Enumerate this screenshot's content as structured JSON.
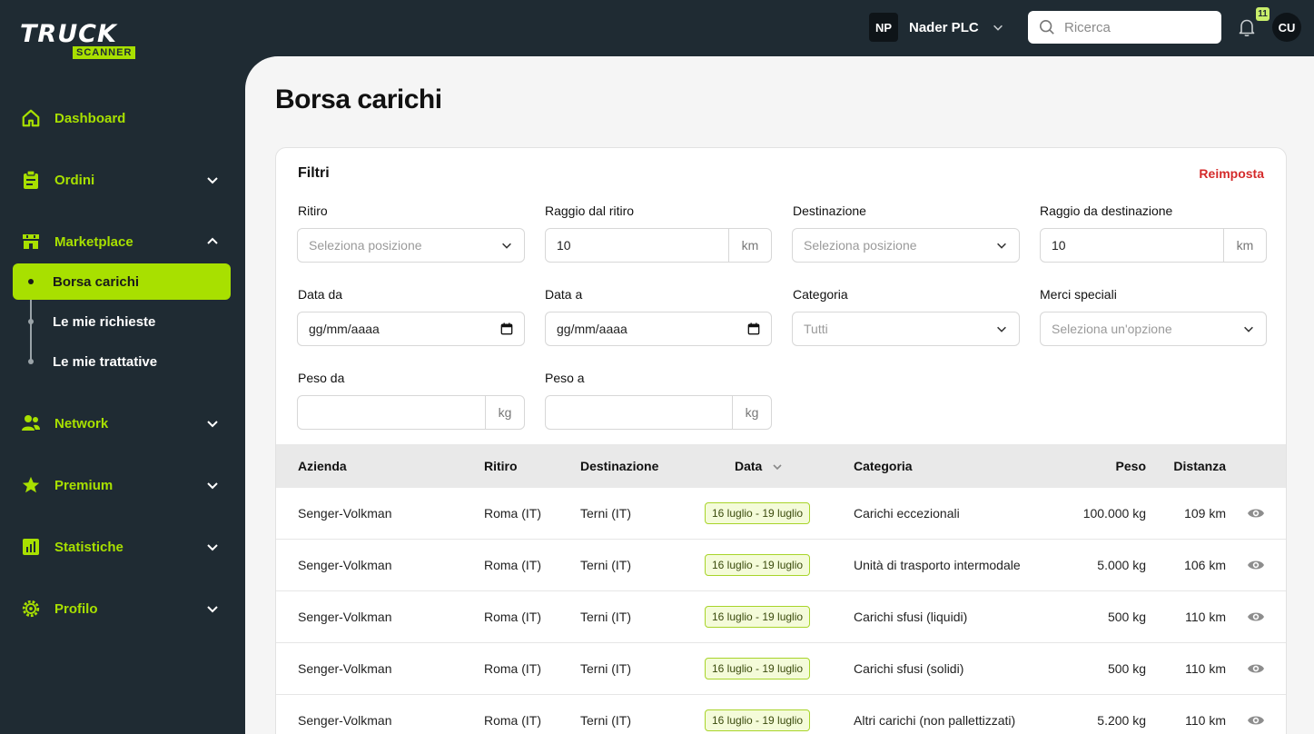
{
  "brand": {
    "top": "TRUCK",
    "bottom": "SCANNER"
  },
  "sidebar": {
    "items": [
      {
        "label": "Dashboard",
        "icon": "home-icon"
      },
      {
        "label": "Ordini",
        "icon": "clipboard-icon"
      },
      {
        "label": "Marketplace",
        "icon": "marketplace-icon"
      },
      {
        "label": "Network",
        "icon": "users-icon"
      },
      {
        "label": "Premium",
        "icon": "star-icon"
      },
      {
        "label": "Statistiche",
        "icon": "bar-chart-icon"
      },
      {
        "label": "Profilo",
        "icon": "gear-icon"
      }
    ],
    "marketplace_sub": [
      {
        "label": "Borsa carichi",
        "active": true
      },
      {
        "label": "Le mie richieste",
        "active": false
      },
      {
        "label": "Le mie trattative",
        "active": false
      }
    ]
  },
  "topbar": {
    "company_initials": "NP",
    "company_name": "Nader PLC",
    "search_placeholder": "Ricerca",
    "notifications": "11",
    "user_initials": "CU"
  },
  "page": {
    "title": "Borsa carichi"
  },
  "filters": {
    "title": "Filtri",
    "reset": "Reimposta",
    "pickup_label": "Ritiro",
    "pickup_placeholder": "Seleziona posizione",
    "pickup_radius_label": "Raggio dal ritiro",
    "pickup_radius_value": "10",
    "destination_label": "Destinazione",
    "destination_placeholder": "Seleziona posizione",
    "destination_radius_label": "Raggio da destinazione",
    "destination_radius_value": "10",
    "km_unit": "km",
    "date_from_label": "Data da",
    "date_from_placeholder": "gg/mm/aaaa",
    "date_to_label": "Data a",
    "date_to_placeholder": "gg/mm/aaaa",
    "category_label": "Categoria",
    "category_value": "Tutti",
    "special_label": "Merci speciali",
    "special_placeholder": "Seleziona un'opzione",
    "weight_from_label": "Peso da",
    "weight_to_label": "Peso a",
    "kg_unit": "kg"
  },
  "table": {
    "headers": {
      "company": "Azienda",
      "pickup": "Ritiro",
      "destination": "Destinazione",
      "date": "Data",
      "category": "Categoria",
      "weight": "Peso",
      "distance": "Distanza"
    },
    "rows": [
      {
        "company": "Senger-Volkman",
        "pickup": "Roma (IT)",
        "destination": "Terni (IT)",
        "date": "16 luglio - 19 luglio",
        "category": "Carichi eccezionali",
        "weight": "100.000 kg",
        "distance": "109 km"
      },
      {
        "company": "Senger-Volkman",
        "pickup": "Roma (IT)",
        "destination": "Terni (IT)",
        "date": "16 luglio - 19 luglio",
        "category": "Unità di trasporto intermodale",
        "weight": "5.000 kg",
        "distance": "106 km"
      },
      {
        "company": "Senger-Volkman",
        "pickup": "Roma (IT)",
        "destination": "Terni (IT)",
        "date": "16 luglio - 19 luglio",
        "category": "Carichi sfusi (liquidi)",
        "weight": "500 kg",
        "distance": "110 km"
      },
      {
        "company": "Senger-Volkman",
        "pickup": "Roma (IT)",
        "destination": "Terni (IT)",
        "date": "16 luglio - 19 luglio",
        "category": "Carichi sfusi (solidi)",
        "weight": "500 kg",
        "distance": "110 km"
      },
      {
        "company": "Senger-Volkman",
        "pickup": "Roma (IT)",
        "destination": "Terni (IT)",
        "date": "16 luglio - 19 luglio",
        "category": "Altri carichi (non pallettizzati)",
        "weight": "5.200 kg",
        "distance": "110 km"
      }
    ]
  },
  "colors": {
    "accent": "#a8e000",
    "sidebar_bg": "#1f2b33",
    "danger": "#d42a2a"
  }
}
